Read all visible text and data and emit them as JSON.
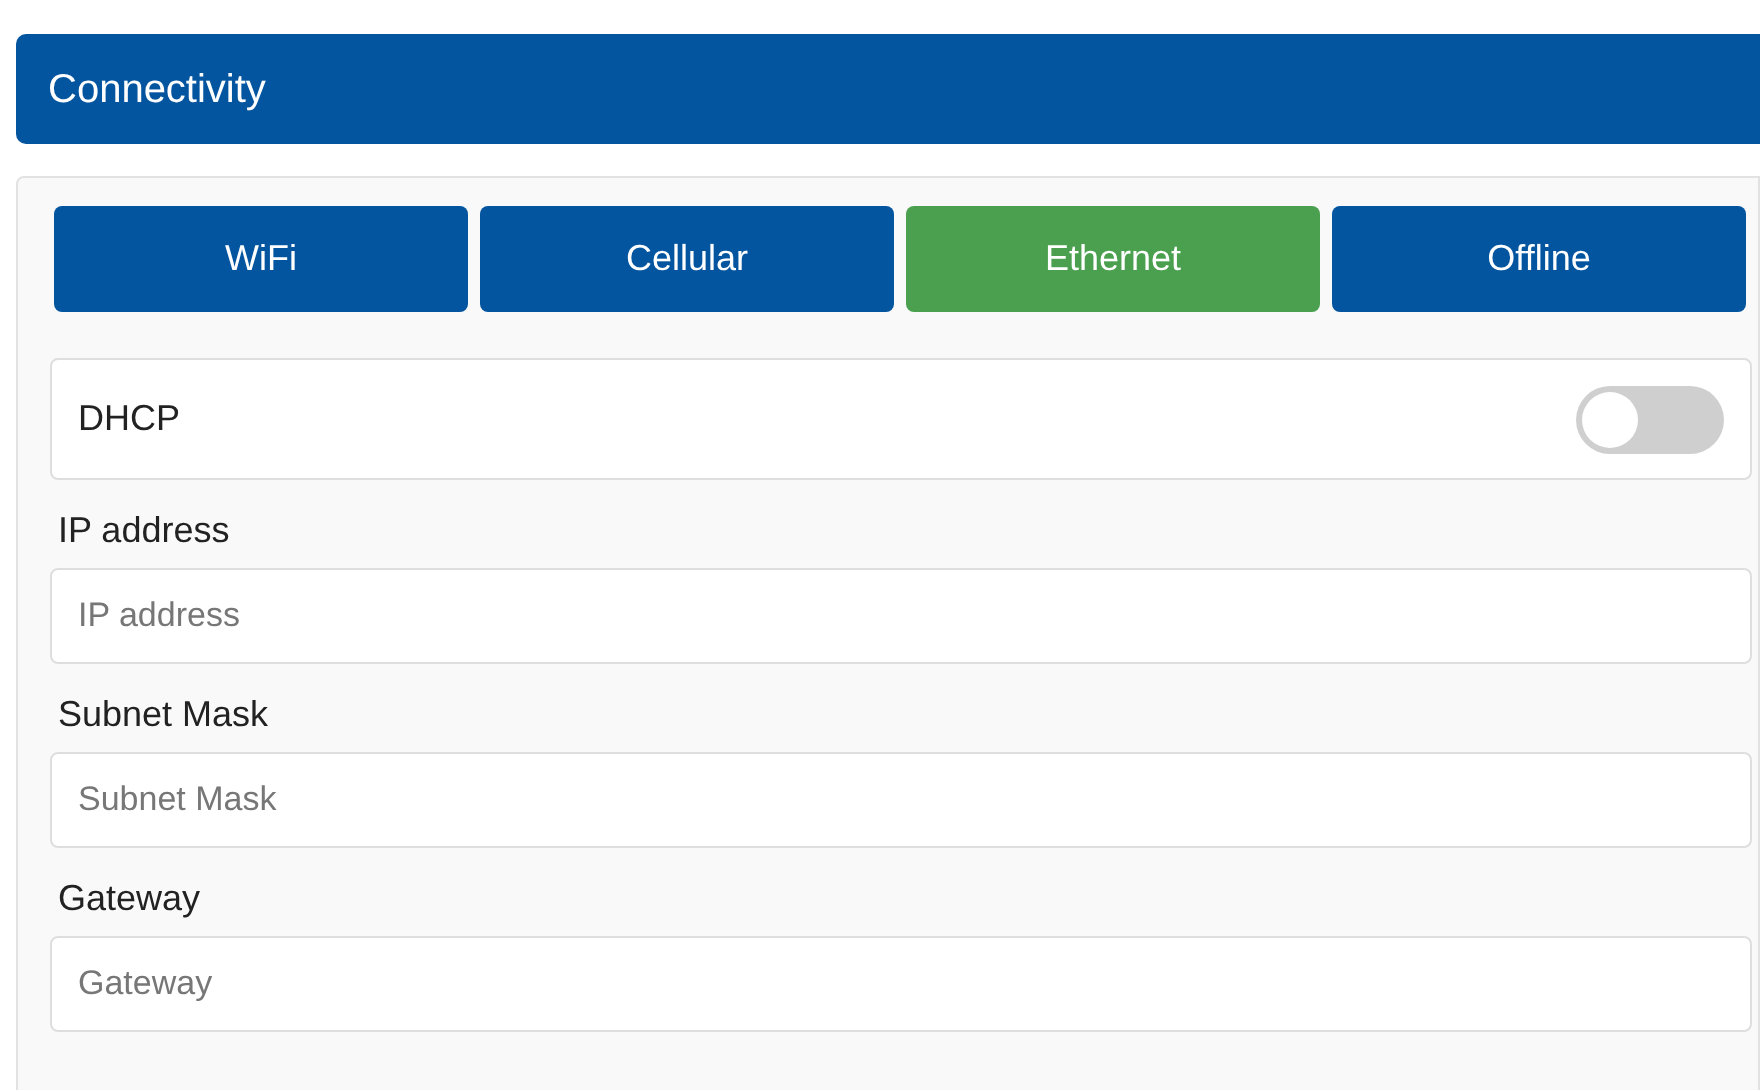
{
  "header": {
    "title": "Connectivity"
  },
  "tabs": [
    {
      "label": "WiFi",
      "selected": false
    },
    {
      "label": "Cellular",
      "selected": false
    },
    {
      "label": "Ethernet",
      "selected": true
    },
    {
      "label": "Offline",
      "selected": false
    }
  ],
  "dhcp": {
    "label": "DHCP",
    "on": false
  },
  "fields": [
    {
      "label": "IP address",
      "placeholder": "IP address"
    },
    {
      "label": "Subnet Mask",
      "placeholder": "Subnet Mask"
    },
    {
      "label": "Gateway",
      "placeholder": "Gateway"
    }
  ]
}
